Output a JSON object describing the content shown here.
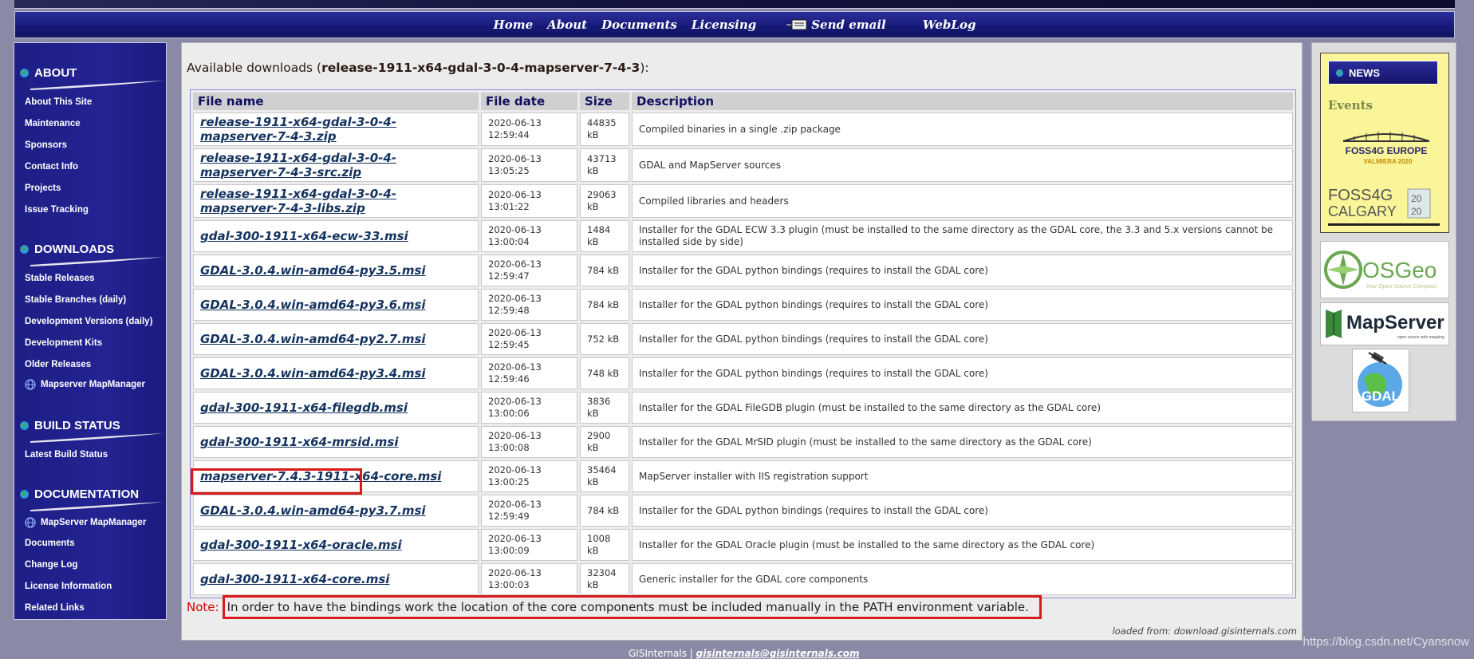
{
  "topnav": {
    "home": "Home",
    "about": "About",
    "documents": "Documents",
    "licensing": "Licensing",
    "send_email": "Send email",
    "weblog": "WebLog"
  },
  "sidebar": {
    "about": {
      "title": "ABOUT",
      "items": [
        "About This Site",
        "Maintenance",
        "Sponsors",
        "Contact Info",
        "Projects",
        "Issue Tracking"
      ]
    },
    "downloads": {
      "title": "DOWNLOADS",
      "items": [
        "Stable Releases",
        "Stable Branches (daily)",
        "Development Versions (daily)",
        "Development Kits",
        "Older Releases",
        "Mapserver MapManager"
      ]
    },
    "build_status": {
      "title": "BUILD STATUS",
      "items": [
        "Latest Build Status"
      ]
    },
    "documentation": {
      "title": "DOCUMENTATION",
      "items": [
        "MapServer MapManager",
        "Documents",
        "Change Log",
        "License Information",
        "Related Links"
      ]
    }
  },
  "main": {
    "available_prefix": "Available downloads (",
    "release": "release-1911-x64-gdal-3-0-4-mapserver-7-4-3",
    "available_suffix": "):",
    "columns": [
      "File name",
      "File date",
      "Size",
      "Description"
    ],
    "rows": [
      {
        "name": "release-1911-x64-gdal-3-0-4-mapserver-7-4-3.zip",
        "date": "2020-06-13 12:59:44",
        "size": "44835 kB",
        "desc": "Compiled binaries in a single .zip package"
      },
      {
        "name": "release-1911-x64-gdal-3-0-4-mapserver-7-4-3-src.zip",
        "date": "2020-06-13 13:05:25",
        "size": "43713 kB",
        "desc": "GDAL and MapServer sources"
      },
      {
        "name": "release-1911-x64-gdal-3-0-4-mapserver-7-4-3-libs.zip",
        "date": "2020-06-13 13:01:22",
        "size": "29063 kB",
        "desc": "Compiled libraries and headers"
      },
      {
        "name": "gdal-300-1911-x64-ecw-33.msi",
        "date": "2020-06-13 13:00:04",
        "size": "1484 kB",
        "desc": "Installer for the GDAL ECW 3.3 plugin (must be installed to the same directory as the GDAL core, the 3.3 and 5.x versions cannot be installed side by side)"
      },
      {
        "name": "GDAL-3.0.4.win-amd64-py3.5.msi",
        "date": "2020-06-13 12:59:47",
        "size": "784 kB",
        "desc": "Installer for the GDAL python bindings (requires to install the GDAL core)"
      },
      {
        "name": "GDAL-3.0.4.win-amd64-py3.6.msi",
        "date": "2020-06-13 12:59:48",
        "size": "784 kB",
        "desc": "Installer for the GDAL python bindings (requires to install the GDAL core)"
      },
      {
        "name": "GDAL-3.0.4.win-amd64-py2.7.msi",
        "date": "2020-06-13 12:59:45",
        "size": "752 kB",
        "desc": "Installer for the GDAL python bindings (requires to install the GDAL core)"
      },
      {
        "name": "GDAL-3.0.4.win-amd64-py3.4.msi",
        "date": "2020-06-13 12:59:46",
        "size": "748 kB",
        "desc": "Installer for the GDAL python bindings (requires to install the GDAL core)"
      },
      {
        "name": "gdal-300-1911-x64-filegdb.msi",
        "date": "2020-06-13 13:00:06",
        "size": "3836 kB",
        "desc": "Installer for the GDAL FileGDB plugin (must be installed to the same directory as the GDAL core)"
      },
      {
        "name": "gdal-300-1911-x64-mrsid.msi",
        "date": "2020-06-13 13:00:08",
        "size": "2900 kB",
        "desc": "Installer for the GDAL MrSID plugin (must be installed to the same directory as the GDAL core)"
      },
      {
        "name": "mapserver-7.4.3-1911-x64-core.msi",
        "date": "2020-06-13 13:00:25",
        "size": "35464 kB",
        "desc": "MapServer installer with IIS registration support"
      },
      {
        "name": "GDAL-3.0.4.win-amd64-py3.7.msi",
        "date": "2020-06-13 12:59:49",
        "size": "784 kB",
        "desc": "Installer for the GDAL python bindings (requires to install the GDAL core)"
      },
      {
        "name": "gdal-300-1911-x64-oracle.msi",
        "date": "2020-06-13 13:00:09",
        "size": "1008 kB",
        "desc": "Installer for the GDAL Oracle plugin (must be installed to the same directory as the GDAL core)"
      },
      {
        "name": "gdal-300-1911-x64-core.msi",
        "date": "2020-06-13 13:00:03",
        "size": "32304 kB",
        "desc": "Generic installer for the GDAL core components"
      }
    ],
    "note_label": "Note:",
    "note_text": "In order to have the bindings work the location of the core components must be included manually in the PATH environment variable.",
    "loaded_from": "loaded from: download.gisinternals.com"
  },
  "right": {
    "news_title": "NEWS",
    "events": "Events",
    "foss_europe_line1": "FOSS4G EUROPE",
    "foss_europe_line2": "VALMIERA 2020",
    "foss_calgary_line1": "FOSS4G",
    "foss_calgary_line2": "CALGARY",
    "osgeo": "OSGeo",
    "osgeo_tag": "Your Open Source Compass",
    "mapserver": "MapServer",
    "mapserver_tag": "open source web mapping",
    "gdal": "GDAL"
  },
  "footer": {
    "site": "GISInternals |",
    "email": "gisinternals@gisinternals.com"
  },
  "watermark": "https://blog.csdn.net/Cyansnow",
  "colors": {
    "accent_red": "#d81a1a",
    "nav_blue": "#161a78",
    "link": "#14335e"
  }
}
